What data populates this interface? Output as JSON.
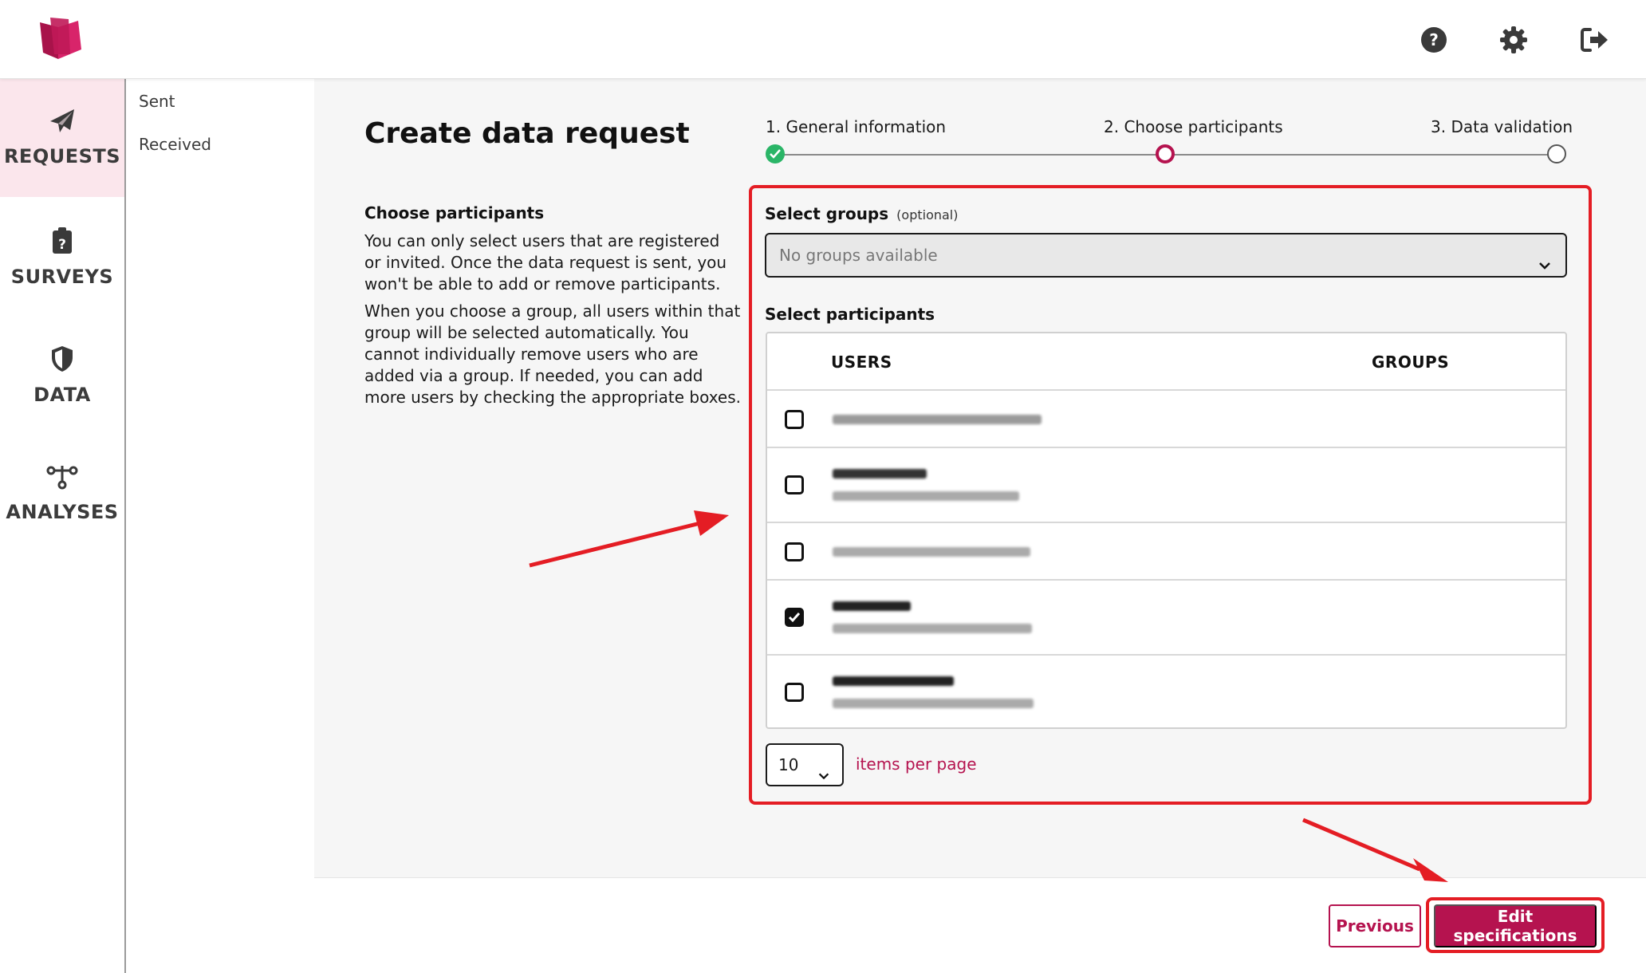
{
  "header": {
    "logo": "book-logo",
    "icons": [
      "help-icon",
      "settings-icon",
      "logout-icon"
    ]
  },
  "sidebar": {
    "items": [
      {
        "label": "REQUESTS",
        "icon": "paper-plane-icon",
        "active": true
      },
      {
        "label": "SURVEYS",
        "icon": "clipboard-question-icon",
        "active": false
      },
      {
        "label": "DATA",
        "icon": "shield-icon",
        "active": false
      },
      {
        "label": "ANALYSES",
        "icon": "network-icon",
        "active": false
      }
    ]
  },
  "subnav": {
    "items": [
      {
        "label": "Sent"
      },
      {
        "label": "Received"
      }
    ]
  },
  "page": {
    "title": "Create data request",
    "section_title": "Choose participants",
    "paragraph_1": "You can only select users that are registered or invited. Once the data request is sent, you won't be able to add or remove participants.",
    "paragraph_2": "When you choose a group, all users within that group will be selected automatically. You cannot individually remove users who are added via a group. If needed, you can add more users by checking the appropriate boxes."
  },
  "stepper": {
    "steps": [
      {
        "label": "1. General information",
        "state": "completed"
      },
      {
        "label": "2. Choose participants",
        "state": "current"
      },
      {
        "label": "3. Data validation",
        "state": "upcoming"
      }
    ]
  },
  "form": {
    "groups_label": "Select groups",
    "groups_optional": "(optional)",
    "groups_placeholder": "No groups available",
    "participants_label": "Select participants",
    "table": {
      "columns": [
        "USERS",
        "GROUPS"
      ],
      "rows": [
        {
          "checked": false,
          "lines": 1
        },
        {
          "checked": false,
          "lines": 2
        },
        {
          "checked": false,
          "lines": 1
        },
        {
          "checked": true,
          "lines": 2
        },
        {
          "checked": false,
          "lines": 2
        }
      ]
    },
    "page_size": "10",
    "page_size_label": "items per page"
  },
  "footer": {
    "previous_label": "Previous",
    "next_label": "Edit specifications"
  },
  "colors": {
    "accent": "#b5134f",
    "highlight": "#e41d24",
    "success": "#2ab567",
    "active_nav_bg": "#fbe6ec"
  }
}
